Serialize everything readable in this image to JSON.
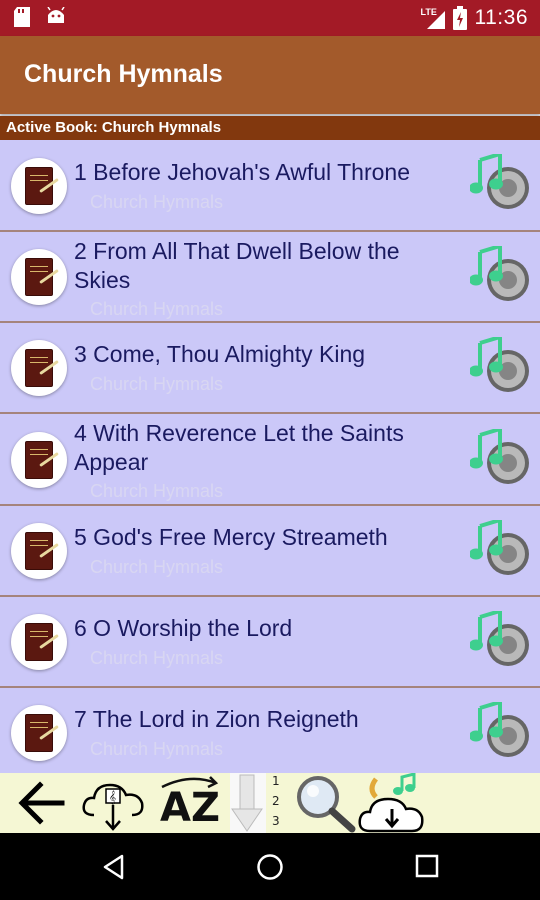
{
  "status": {
    "network": "LTE",
    "time": "11:36"
  },
  "app_bar": {
    "title": "Church Hymnals"
  },
  "active_book": {
    "text": "Active Book: Church Hymnals"
  },
  "hymns": [
    {
      "title": "1 Before Jehovah's Awful Throne",
      "book": "Church Hymnals"
    },
    {
      "title": "2 From All That Dwell Below the Skies",
      "book": "Church Hymnals"
    },
    {
      "title": "3 Come, Thou Almighty King",
      "book": "Church Hymnals"
    },
    {
      "title": "4 With Reverence Let the Saints Appear",
      "book": "Church Hymnals"
    },
    {
      "title": "5 God's Free Mercy Streameth",
      "book": "Church Hymnals"
    },
    {
      "title": "6 O Worship the Lord",
      "book": "Church Hymnals"
    },
    {
      "title": "7 The Lord in Zion Reigneth",
      "book": "Church Hymnals"
    }
  ],
  "toolbar": {
    "items": [
      "back-arrow-icon",
      "cloud-music-download-icon",
      "sort-az-icon",
      "number-sort-icon",
      "search-icon",
      "cloud-download-icon"
    ],
    "sort_text": "AZ",
    "numbers": [
      "1",
      "2",
      "3"
    ]
  },
  "colors": {
    "status_bar": "#a31a26",
    "app_bar": "#a35a2b",
    "active_bar": "#82380e",
    "list_bg": "#cbc8f8",
    "title_text": "#1a1a60",
    "toolbar_bg": "#f5f7d4",
    "music_note": "#3ecf8e"
  }
}
